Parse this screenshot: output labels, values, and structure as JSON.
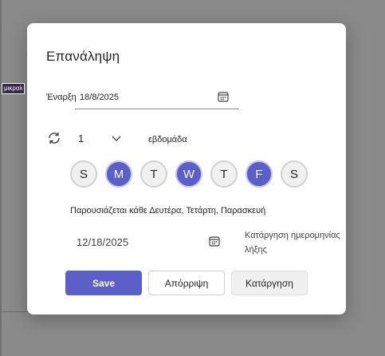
{
  "background": {
    "chip_text": "μικραίι"
  },
  "dialog": {
    "title": "Επανάληψη",
    "start": {
      "prefix": "Έναρξη",
      "value": "18/8/2025"
    },
    "interval": {
      "value": "1",
      "unit": "εβδομάδα"
    },
    "days": [
      {
        "label": "S",
        "selected": false
      },
      {
        "label": "M",
        "selected": true
      },
      {
        "label": "T",
        "selected": false
      },
      {
        "label": "W",
        "selected": true
      },
      {
        "label": "T",
        "selected": false
      },
      {
        "label": "F",
        "selected": true
      },
      {
        "label": "S",
        "selected": false
      }
    ],
    "summary": "Παρουσιάζεται κάθε Δευτέρα, Τετάρτη, Παρασκευή",
    "end_date": "12/18/2025",
    "remove_end_date": "Κατάργηση ημερομηνίας λήξης",
    "buttons": {
      "save": "Save",
      "discard": "Απόρριψη",
      "remove": "Κατάργηση"
    }
  },
  "colors": {
    "accent": "#5b5fc7",
    "overlay": "#8a8a8a"
  },
  "icons": [
    "calendar-icon",
    "repeat-icon",
    "chevron-down-icon"
  ]
}
